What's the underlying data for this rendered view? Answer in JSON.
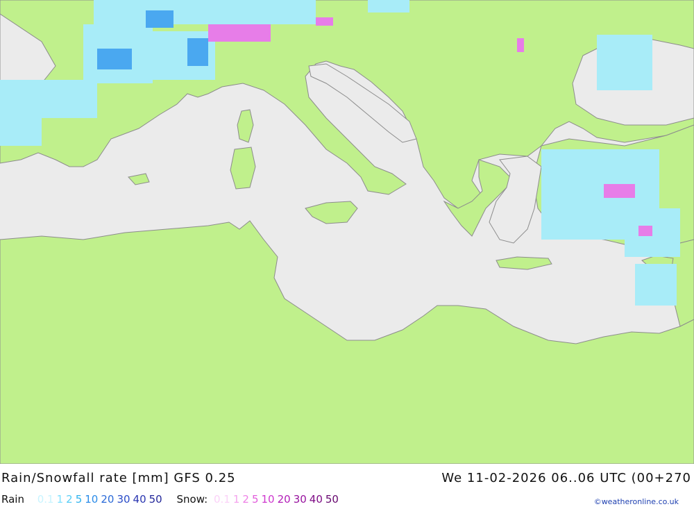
{
  "colors": {
    "sea": "#ebebeb",
    "land": "#c0f08c",
    "coast": "#8c8c8c",
    "rain_light": "#a8ecf8",
    "rain_mid": "#7fe0ff",
    "rain_heavy": "#4aa8f0",
    "snow_light": "#f4b8f0",
    "snow_mid": "#e77de8",
    "credit": "#1d3fb0"
  },
  "footer": {
    "title": "Rain/Snowfall rate [mm] GFS 0.25",
    "datetime": "We 11-02-2026 06..06 UTC (00+270",
    "rain_label": "Rain",
    "rain_scale": [
      {
        "text": "0.1",
        "color": "#c8f4ff"
      },
      {
        "text": "1",
        "color": "#7fe0ff"
      },
      {
        "text": "2",
        "color": "#55ccf6"
      },
      {
        "text": "5",
        "color": "#2eb2ee"
      },
      {
        "text": "10",
        "color": "#2a8be8"
      },
      {
        "text": "20",
        "color": "#2a6ad8"
      },
      {
        "text": "30",
        "color": "#2a4cc8"
      },
      {
        "text": "40",
        "color": "#2a36b0"
      },
      {
        "text": "50",
        "color": "#24289a"
      }
    ],
    "snow_label": "Snow:",
    "snow_scale": [
      {
        "text": "0.1",
        "color": "#fbd2f8"
      },
      {
        "text": "1",
        "color": "#f4a4ee"
      },
      {
        "text": "2",
        "color": "#ee80e6"
      },
      {
        "text": "5",
        "color": "#e25cdc"
      },
      {
        "text": "10",
        "color": "#cf38cf"
      },
      {
        "text": "20",
        "color": "#b21db8"
      },
      {
        "text": "30",
        "color": "#97129e"
      },
      {
        "text": "40",
        "color": "#7e0c86"
      },
      {
        "text": "50",
        "color": "#66076e"
      }
    ],
    "credit": "©weatheronline.co.uk"
  }
}
